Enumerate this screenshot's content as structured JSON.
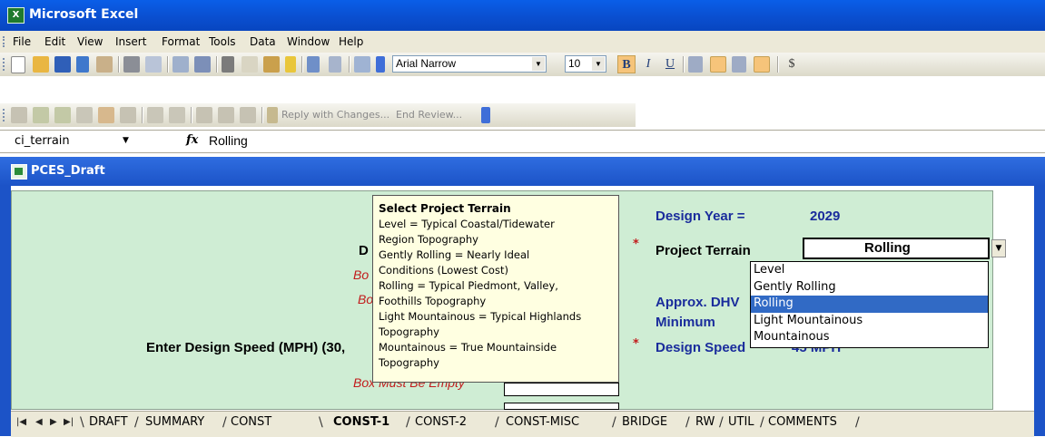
{
  "app": {
    "title": "Microsoft Excel",
    "icon": "excel-icon"
  },
  "menu": [
    "File",
    "Edit",
    "View",
    "Insert",
    "Format",
    "Tools",
    "Data",
    "Window",
    "Help"
  ],
  "format_toolbar": {
    "font": "Arial Narrow",
    "size": "10",
    "bold": "B",
    "italic": "I",
    "underline": "U",
    "currency": "$"
  },
  "review_toolbar": {
    "reply": "Reply with Changes...",
    "end": "End Review..."
  },
  "formula_bar": {
    "name_box": "ci_terrain",
    "fx": "fx",
    "value": "Rolling"
  },
  "workbook": {
    "title": "PCES_Draft"
  },
  "sheet": {
    "design_year_label": "Design Year =",
    "design_year_value": "2029",
    "d_label": "D",
    "project_terrain_label": "Project Terrain",
    "project_terrain_value": "Rolling",
    "approx_dhv_label": "Approx. DHV",
    "minimum_label": "Minimum",
    "design_speed_label": "Design Speed",
    "design_speed_value": "45 MPH",
    "enter_speed_label": "Enter Design Speed (MPH) (30,",
    "bo_note": "Bo",
    "bo_note2": "Bo",
    "box_note": "Box Must Be Empty",
    "required_mark": "*"
  },
  "comment": {
    "heading": "Select Project Terrain",
    "lines": [
      "Level = Typical Coastal/Tidewater",
      "Region Topography",
      "Gently Rolling = Nearly Ideal",
      "Conditions (Lowest Cost)",
      "Rolling = Typical Piedmont, Valley,",
      "Foothills Topography",
      "Light Mountainous = Typical Highlands",
      "Topography",
      "Mountainous = True Mountainside",
      "Topography"
    ]
  },
  "terrain_options": [
    "Level",
    "Gently Rolling",
    "Rolling",
    "Light Mountainous",
    "Mountainous"
  ],
  "terrain_selected": "Rolling",
  "tabs": [
    "DRAFT",
    "SUMMARY",
    "CONST",
    "CONST-1",
    "CONST-2",
    "CONST-MISC",
    "BRIDGE",
    "RW",
    "UTIL",
    "COMMENTS"
  ],
  "active_tab": "CONST-1",
  "colors": {
    "title_blue": "#0a4fd0",
    "sheet_green": "#cfedd4",
    "label_blue": "#1a2c9c",
    "required_red": "#c21c1c",
    "selection_blue": "#316ac5"
  }
}
